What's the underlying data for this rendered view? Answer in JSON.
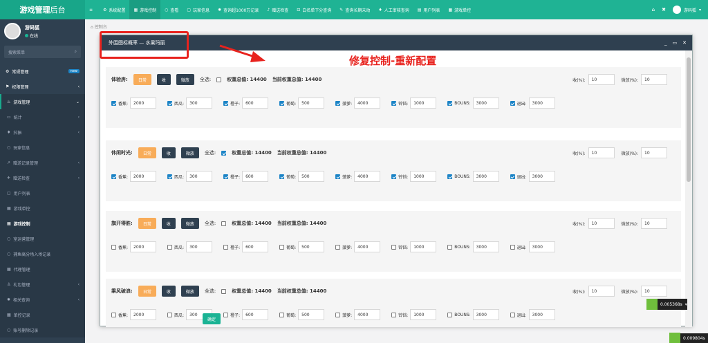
{
  "brand": {
    "bold": "游戏管理",
    "thin": "后台"
  },
  "topnav": [
    {
      "icon": "≡",
      "label": ""
    },
    {
      "icon": "⚙",
      "label": "系统配置"
    },
    {
      "icon": "▦",
      "label": "游戏控制",
      "active": true
    },
    {
      "icon": "○",
      "label": "查看"
    },
    {
      "icon": "▢",
      "label": "玩家信息"
    },
    {
      "icon": "✹",
      "label": "查询超1000万记录"
    },
    {
      "icon": "♪",
      "label": "赠送检查"
    },
    {
      "icon": "⊟",
      "label": "白名单下分查询"
    },
    {
      "icon": "✎",
      "label": "查询长期未动"
    },
    {
      "icon": "♦",
      "label": "人工审核查询"
    },
    {
      "icon": "▤",
      "label": "用户列表"
    },
    {
      "icon": "▦",
      "label": "游戏单控"
    }
  ],
  "topright": {
    "home": "⌂",
    "tools": "✖",
    "user": "游码狐",
    "caret": "▾"
  },
  "profile": {
    "name": "游码狐",
    "status": "在线"
  },
  "side_search_placeholder": "搜索菜单",
  "menu": [
    {
      "icon": "⚙",
      "label": "常规管理",
      "badge": "new",
      "type": "main"
    },
    {
      "icon": "⚑",
      "label": "权限管理",
      "arrow": "‹",
      "type": "main"
    },
    {
      "icon": "♨",
      "label": "游戏管理",
      "arrow": "⌄",
      "type": "active"
    },
    {
      "icon": "▭",
      "label": "统计",
      "arrow": "‹",
      "type": "sub"
    },
    {
      "icon": "♦",
      "label": "抖振",
      "arrow": "‹",
      "type": "sub"
    },
    {
      "icon": "○",
      "label": "玩家信息",
      "type": "sub"
    },
    {
      "icon": "↗",
      "label": "赠送记录管理",
      "arrow": "‹",
      "type": "sub"
    },
    {
      "icon": "✈",
      "label": "赠送检查",
      "arrow": "‹",
      "type": "sub"
    },
    {
      "icon": "▢",
      "label": "用户列表",
      "type": "sub"
    },
    {
      "icon": "▦",
      "label": "游戏单控",
      "type": "sub"
    },
    {
      "icon": "▦",
      "label": "游戏控制",
      "type": "current"
    },
    {
      "icon": "○",
      "label": "室运营管理",
      "type": "sub"
    },
    {
      "icon": "○",
      "label": "捕鱼高分场入场记录",
      "type": "sub"
    },
    {
      "icon": "▦",
      "label": "代理管理",
      "type": "sub"
    },
    {
      "icon": "♙",
      "label": "礼包管理",
      "arrow": "‹",
      "type": "sub"
    },
    {
      "icon": "✹",
      "label": "相关查询",
      "arrow": "‹",
      "type": "sub"
    },
    {
      "icon": "▦",
      "label": "单控记录",
      "type": "sub"
    },
    {
      "icon": "○",
      "label": "账号删除记录",
      "type": "sub"
    }
  ],
  "breadcrumb": "控制台",
  "modal": {
    "title": "外围图标概率 — 水果玛丽",
    "ctrl_min": "_",
    "ctrl_max": "▭",
    "ctrl_close": "✕",
    "confirm": "确定"
  },
  "labels": {
    "normal": "日常",
    "collect": "收",
    "micro": "微放",
    "select_all": "全选:",
    "weight_total": "权重总值: 14400",
    "current_weight_total": "当前权重总值: 14400",
    "collect_pct": "收(%):",
    "micro_pct": "微放(%):"
  },
  "rooms": [
    {
      "name": "体验房:",
      "all_checked": false,
      "collect": "10",
      "micro": "10",
      "fruits_checked": true
    },
    {
      "name": "休闲时光:",
      "all_checked": true,
      "collect": "10",
      "micro": "10",
      "fruits_checked": true
    },
    {
      "name": "旗开得胜:",
      "all_checked": false,
      "collect": "10",
      "micro": "10",
      "fruits_checked": false
    },
    {
      "name": "乘风破浪:",
      "all_checked": false,
      "collect": "10",
      "micro": "10",
      "fruits_checked": false
    }
  ],
  "fruits": [
    {
      "label": "香蕉:",
      "value": "2000"
    },
    {
      "label": "西瓜:",
      "value": "300"
    },
    {
      "label": "橙子:",
      "value": "600"
    },
    {
      "label": "葡萄:",
      "value": "500"
    },
    {
      "label": "菠萝:",
      "value": "4000"
    },
    {
      "label": "铃铛:",
      "value": "1000"
    },
    {
      "label": "BOUNS:",
      "value": "3000"
    },
    {
      "label": "退出:",
      "value": "3000"
    }
  ],
  "annotation": {
    "text": "修复控制-重新配置",
    "color": "#e8231e"
  },
  "timers": {
    "t1": "0.005368s",
    "t2": "0.009804s"
  }
}
